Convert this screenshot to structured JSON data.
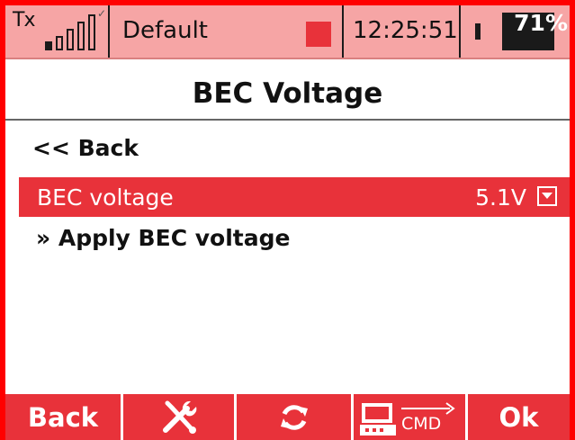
{
  "statusbar": {
    "tx_label": "Tx",
    "model_name": "Default",
    "time": "12:25:51",
    "battery_percent": "71%",
    "battery_level": 0.29
  },
  "title": "BEC Voltage",
  "menu": {
    "back_label": "<<  Back",
    "selected_row": {
      "label": "BEC voltage",
      "value": "5.1V"
    },
    "apply_label": "» Apply BEC voltage"
  },
  "softkeys": {
    "key1": "Back",
    "key2_icon": "wrench-screwdriver-icon",
    "key3_icon": "refresh-icon",
    "key4_icon": "cmd-terminal-icon",
    "key4_label": "CMD",
    "key5": "Ok"
  },
  "colors": {
    "frame": "#ff0000",
    "accent": "#e8323a",
    "statusbar": "#f6a5a5"
  }
}
